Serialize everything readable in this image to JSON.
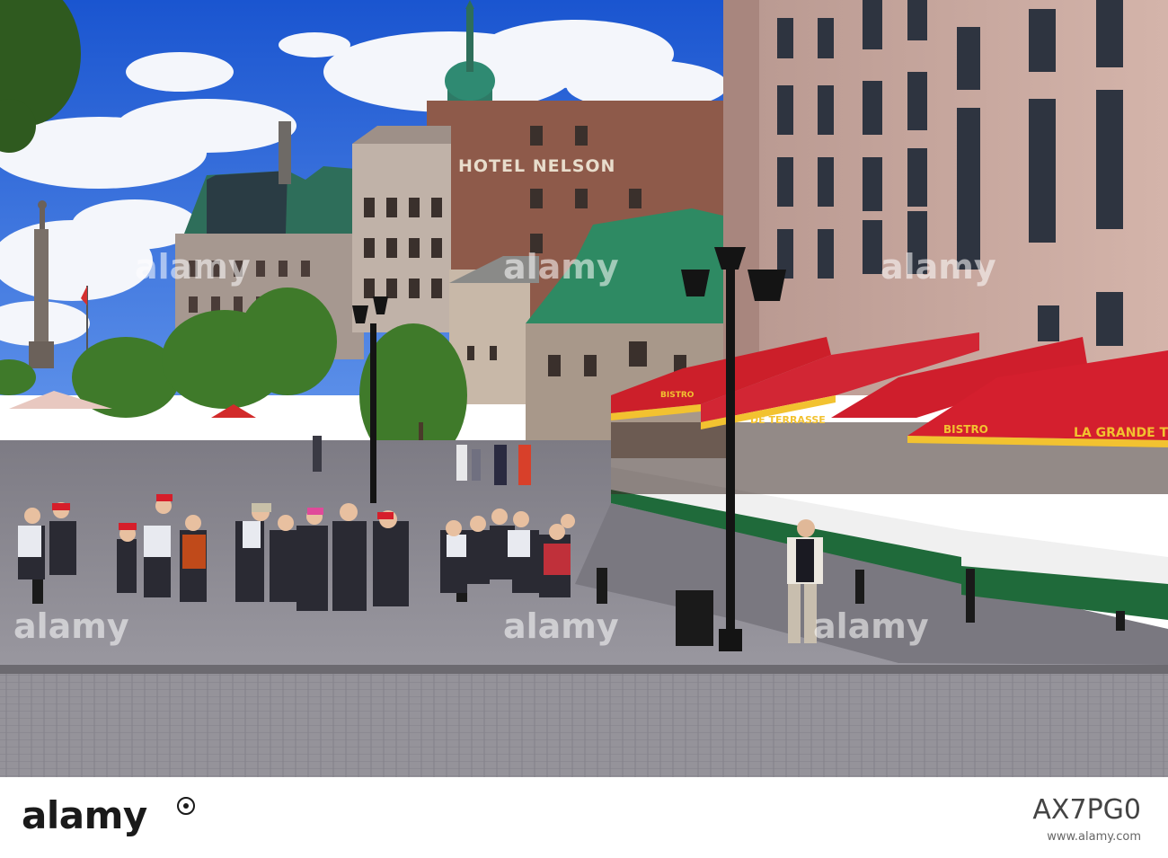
{
  "image": {
    "description_colors": {
      "sky": "#1f5fd8",
      "awning": "#d01e2a",
      "awning_trim": "#f2c230",
      "roof_green": "#2e8a63",
      "stone": "#c9a89e",
      "pavement": "#8e8c93"
    }
  },
  "signs": {
    "hotel": "HOTEL NELSON",
    "awning_1": "BISTRO",
    "awning_2": "DE TERRASSE",
    "awning_3": "BISTRO",
    "awning_4": "LA GRANDE TER"
  },
  "watermark": {
    "text": "alamy"
  },
  "footer": {
    "logo": "alamy",
    "credit": "",
    "image_id": "AX7PG0",
    "url": "www.alamy.com"
  }
}
